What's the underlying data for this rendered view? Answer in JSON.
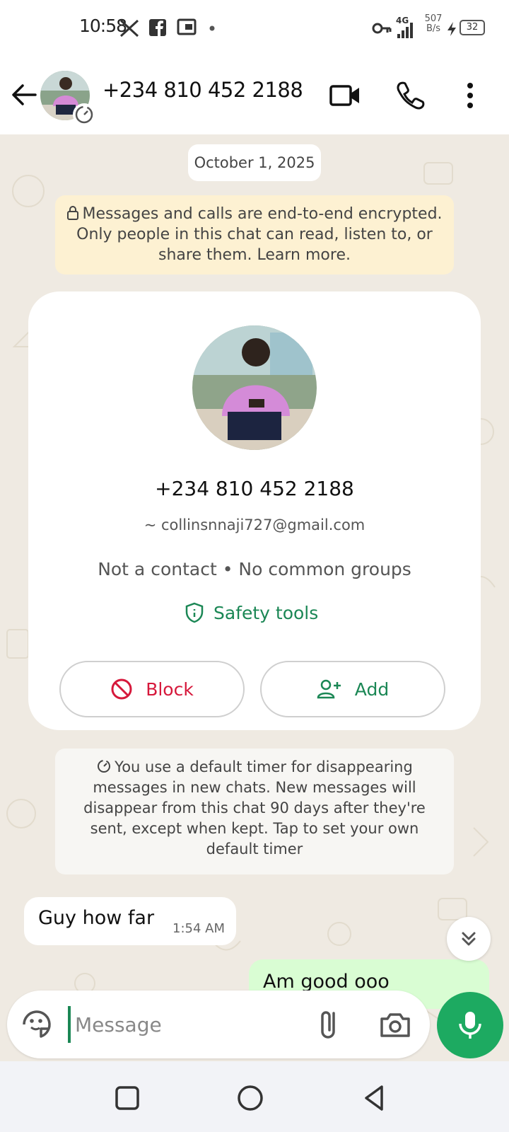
{
  "status_bar": {
    "time": "10:58",
    "network_type": "4G",
    "speed_value": "507",
    "speed_unit": "B/s",
    "battery": "32",
    "icons": [
      "notification-dot",
      "facebook-icon",
      "cast-icon",
      "vpn-key-icon",
      "signal-icon",
      "charging-icon",
      "battery-icon"
    ]
  },
  "header": {
    "title": "+234 810 452 2188"
  },
  "chat": {
    "date_label": "October 1, 2025",
    "encryption_notice": "Messages and calls are end-to-end encrypted. Only people in this chat can read, listen to, or share them. Learn more.",
    "profile_card": {
      "phone": "+234 810 452 2188",
      "email": "~ collinsnnaji727@gmail.com",
      "meta": "Not a contact • No common groups",
      "safety_label": "Safety tools",
      "block_label": "Block",
      "add_label": "Add"
    },
    "timer_notice": "You use a default timer for disappearing messages in new chats. New messages will disappear from this chat 90 days after they're sent, except when kept. Tap to set your own default timer",
    "messages": [
      {
        "direction": "incoming",
        "text": "Guy how far",
        "time": "1:54 AM"
      },
      {
        "direction": "outgoing",
        "text": "Am good ooo"
      }
    ]
  },
  "composer": {
    "placeholder": "Message"
  },
  "colors": {
    "accent_green": "#1daa61",
    "link_green": "#1b8755",
    "block_red": "#d6183b",
    "chat_bg": "#efeae2",
    "encryption_bg": "#fdf1d2",
    "outgoing_bubble": "#d9fdd3"
  }
}
